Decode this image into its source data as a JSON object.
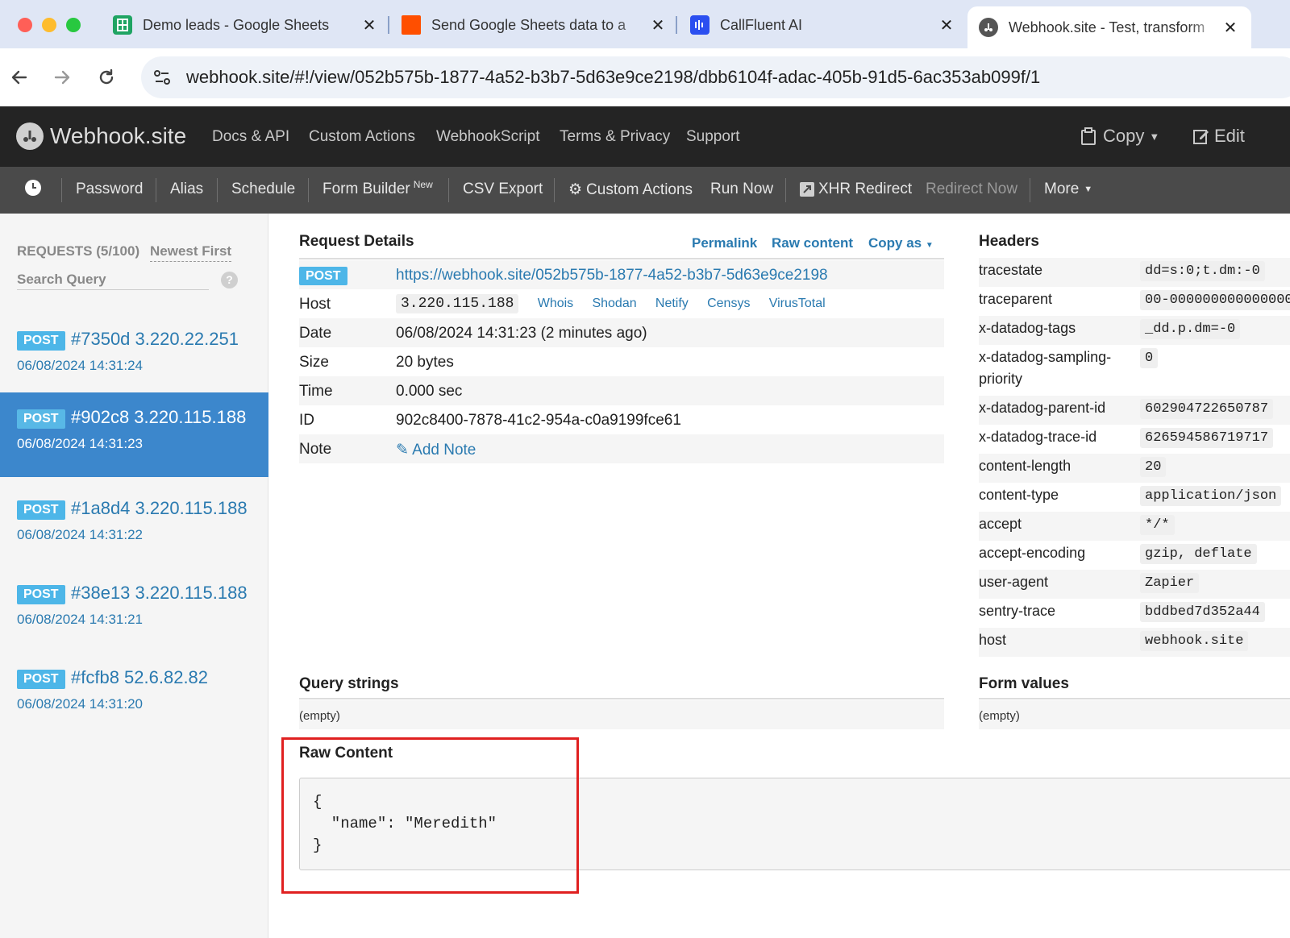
{
  "browser": {
    "tabs": [
      {
        "title": "Demo leads - Google Sheets",
        "icon": "google-sheets-icon",
        "color": "#1fa463"
      },
      {
        "title": "Send Google Sheets data to a",
        "icon": "zapier-icon",
        "color": "#ff4f00"
      },
      {
        "title": "CallFluent AI",
        "icon": "callfluent-icon",
        "color": "#2b4ff0"
      },
      {
        "title": "Webhook.site - Test, transform",
        "icon": "webhook-site-icon",
        "color": "#555555"
      }
    ],
    "close_glyph": "✕",
    "url": "webhook.site/#!/view/052b575b-1877-4a52-b3b7-5d63e9ce2198/dbb6104f-adac-405b-91d5-6ac353ab099f/1"
  },
  "site_nav": {
    "brand": "Webhook.site",
    "links": [
      "Docs & API",
      "Custom Actions",
      "WebhookScript",
      "Terms & Privacy",
      "Support"
    ],
    "copy": "Copy",
    "edit": "Edit"
  },
  "toolbar": {
    "password": "Password",
    "alias": "Alias",
    "schedule": "Schedule",
    "form_builder": "Form Builder",
    "form_builder_badge": "New",
    "csv_export": "CSV Export",
    "custom_actions": "Custom Actions",
    "run_now": "Run Now",
    "xhr_redirect": "XHR Redirect",
    "redirect_now": "Redirect Now",
    "more": "More"
  },
  "sidebar": {
    "requests_label": "REQUESTS (5/100)",
    "sort_label": "Newest First",
    "search_placeholder": "Search Query",
    "help": "?",
    "requests": [
      {
        "method": "POST",
        "title": "#7350d 3.220.22.251",
        "date": "06/08/2024 14:31:24",
        "active": false
      },
      {
        "method": "POST",
        "title": "#902c8 3.220.115.188",
        "date": "06/08/2024 14:31:23",
        "active": true
      },
      {
        "method": "POST",
        "title": "#1a8d4 3.220.115.188",
        "date": "06/08/2024 14:31:22",
        "active": false
      },
      {
        "method": "POST",
        "title": "#38e13 3.220.115.188",
        "date": "06/08/2024 14:31:21",
        "active": false
      },
      {
        "method": "POST",
        "title": "#fcfb8 52.6.82.82",
        "date": "06/08/2024 14:31:20",
        "active": false
      }
    ]
  },
  "details": {
    "title": "Request Details",
    "permalink": "Permalink",
    "raw_content": "Raw content",
    "copy_as": "Copy as",
    "method": "POST",
    "url": "https://webhook.site/052b575b-1877-4a52-b3b7-5d63e9ce2198",
    "host_label": "Host",
    "host": "3.220.115.188",
    "host_links": [
      "Whois",
      "Shodan",
      "Netify",
      "Censys",
      "VirusTotal"
    ],
    "date_label": "Date",
    "date": "06/08/2024 14:31:23 (2 minutes ago)",
    "size_label": "Size",
    "size": "20 bytes",
    "time_label": "Time",
    "time": "0.000 sec",
    "id_label": "ID",
    "id": "902c8400-7878-41c2-954a-c0a9199fce61",
    "note_label": "Note",
    "add_note": "Add Note"
  },
  "headers": {
    "title": "Headers",
    "rows": [
      {
        "k": "tracestate",
        "v": "dd=s:0;t.dm:-0"
      },
      {
        "k": "traceparent",
        "v": "00-000000000000000"
      },
      {
        "k": "x-datadog-tags",
        "v": "_dd.p.dm=-0"
      },
      {
        "k": "x-datadog-sampling-priority",
        "v": "0"
      },
      {
        "k": "x-datadog-parent-id",
        "v": "602904722650787"
      },
      {
        "k": "x-datadog-trace-id",
        "v": "626594586719717"
      },
      {
        "k": "content-length",
        "v": "20"
      },
      {
        "k": "content-type",
        "v": "application/json"
      },
      {
        "k": "accept",
        "v": "*/*"
      },
      {
        "k": "accept-encoding",
        "v": "gzip, deflate"
      },
      {
        "k": "user-agent",
        "v": "Zapier"
      },
      {
        "k": "sentry-trace",
        "v": "bddbed7d352a44"
      },
      {
        "k": "host",
        "v": "webhook.site"
      }
    ]
  },
  "query_strings": {
    "title": "Query strings",
    "value": "(empty)"
  },
  "form_values": {
    "title": "Form values",
    "value": "(empty)"
  },
  "raw": {
    "title": "Raw Content",
    "body": "{\n  \"name\": \"Meredith\"\n}"
  },
  "colors": {
    "accent": "#2a7ab0",
    "active_request": "#3c87cc",
    "method_badge": "#4db6e8",
    "highlight": "#e02020"
  }
}
